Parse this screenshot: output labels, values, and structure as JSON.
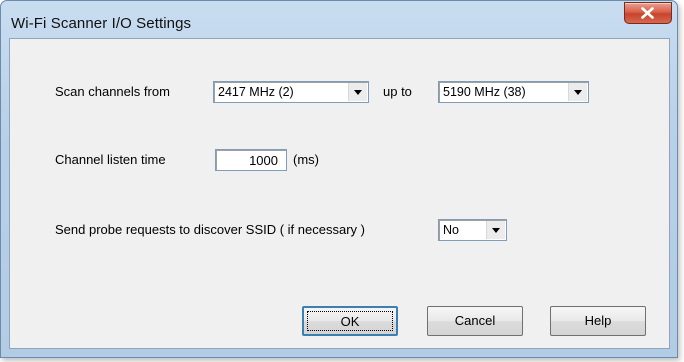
{
  "window": {
    "title": "Wi-Fi Scanner I/O Settings"
  },
  "scan": {
    "label_from": "Scan channels from",
    "from_value": "2417 MHz (2)",
    "label_up_to": "up to",
    "to_value": "5190 MHz (38)"
  },
  "listen": {
    "label": "Channel listen time",
    "value": "1000",
    "unit": "(ms)"
  },
  "probe": {
    "label": "Send probe requests to discover SSID ( if necessary )",
    "value": "No"
  },
  "buttons": {
    "ok": "OK",
    "cancel": "Cancel",
    "help": "Help"
  },
  "colors": {
    "title_gradient_top": "#c9ddf1",
    "close_button": "#c8432c",
    "client_background": "#f0f0f0",
    "default_button_border": "#3c7fb1"
  }
}
